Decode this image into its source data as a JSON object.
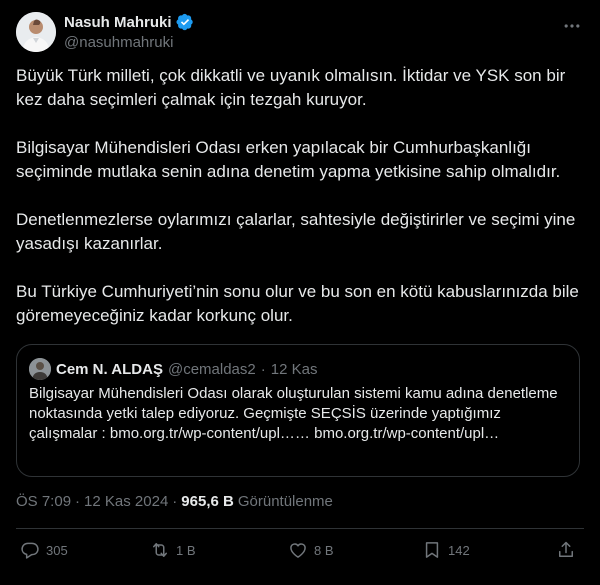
{
  "author": {
    "display_name": "Nasuh Mahruki",
    "handle": "@nasuhmahruki",
    "verified": true
  },
  "paragraphs": [
    "Büyük Türk milleti, çok dikkatli ve uyanık olmalısın. İktidar ve YSK son bir kez daha seçimleri çalmak için tezgah kuruyor.",
    "Bilgisayar Mühendisleri Odası erken yapılacak bir Cumhurbaşkanlığı seçiminde mutlaka senin adına denetim yapma yetkisine sahip olmalıdır.",
    "Denetlenmezlerse oylarımızı çalarlar, sahtesiyle değiştirirler ve seçimi yine yasadışı kazanırlar.",
    "Bu Türkiye Cumhuriyeti’nin sonu olur ve bu son en kötü kabuslarınızda bile göremeyeceğiniz kadar korkunç olur."
  ],
  "quote": {
    "display_name": "Cem N. ALDAŞ",
    "handle": "@cemaldas2",
    "separator": "·",
    "date": "12 Kas",
    "text": "Bilgisayar Mühendisleri Odası olarak oluşturulan sistemi kamu adına denetleme noktasında yetki talep ediyoruz. Geçmişte SEÇSİS üzerinde yaptığımız çalışmalar : bmo.org.tr/wp-content/upl…… bmo.org.tr/wp-content/upl…"
  },
  "meta": {
    "time": "ÖS 7:09",
    "separator": "·",
    "date": "12 Kas 2024",
    "separator2": "·",
    "views_count": "965,6 B",
    "views_label": "Görüntülenme"
  },
  "actions": {
    "replies": "305",
    "reposts": "1 B",
    "likes": "8 B",
    "bookmarks": "142"
  },
  "colors": {
    "background": "#000000",
    "text": "#e7e9ea",
    "muted": "#71767b",
    "border": "#2f3336",
    "verified": "#1d9bf0"
  },
  "icons": {
    "verified": "verified-badge-icon",
    "more": "more-icon",
    "reply": "reply-icon",
    "repost": "repost-icon",
    "like": "heart-icon",
    "bookmark": "bookmark-icon",
    "share": "share-icon"
  }
}
